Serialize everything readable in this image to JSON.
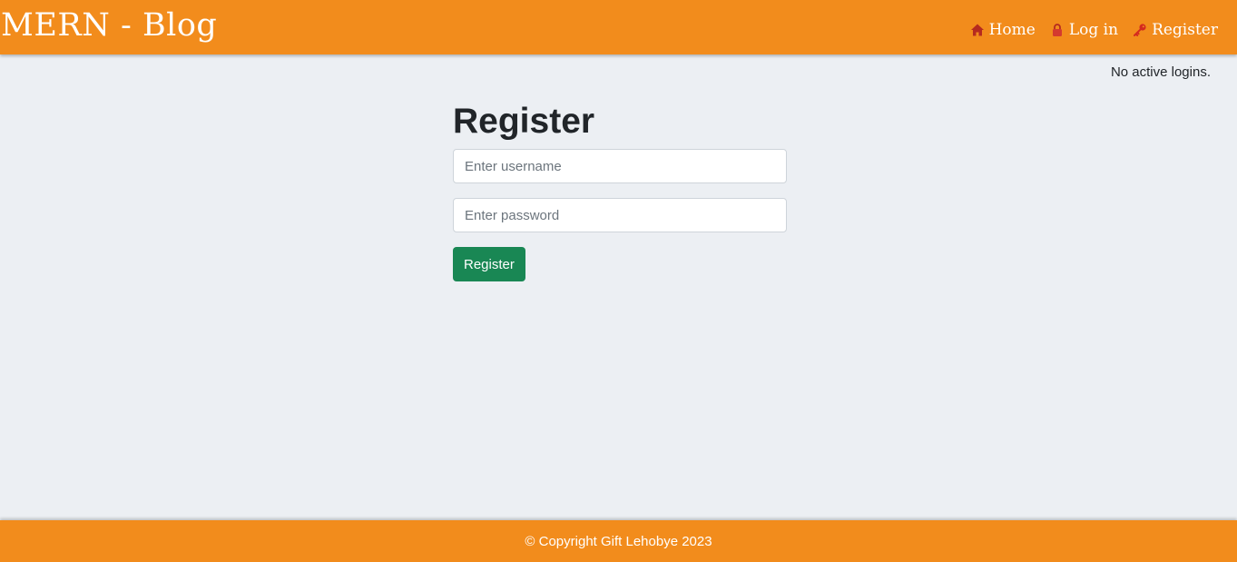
{
  "header": {
    "brand": "MERN - Blog",
    "nav": [
      {
        "label": "Home",
        "icon": "home-icon"
      },
      {
        "label": "Log in",
        "icon": "lock-icon"
      },
      {
        "label": "Register",
        "icon": "key-icon"
      }
    ]
  },
  "status": {
    "text": "No active logins."
  },
  "form": {
    "title": "Register",
    "username_placeholder": "Enter username",
    "password_placeholder": "Enter password",
    "submit_label": "Register"
  },
  "footer": {
    "text": "© Copyright Gift Lehobye 2023"
  },
  "colors": {
    "accent": "#f28c1c",
    "background": "#eceff3",
    "submit": "#198754",
    "icon": "#b52a1f"
  }
}
